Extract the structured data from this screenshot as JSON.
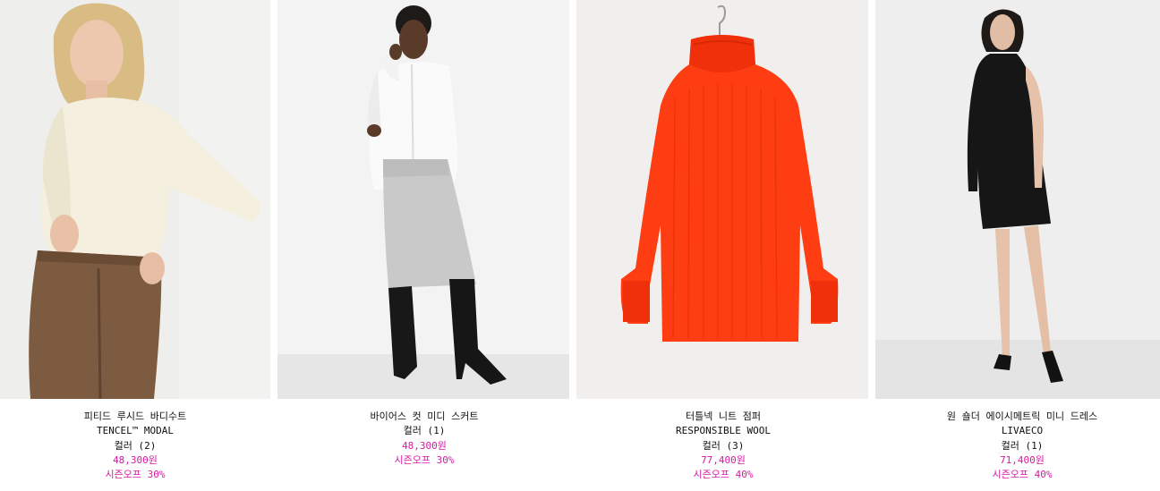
{
  "products": [
    {
      "name": "피티드 루시드 바디수트",
      "subtitle": "TENCEL™ MODAL",
      "colors": "컬러 (2)",
      "price": "48,300원",
      "sale": "시즌오프 30%",
      "image_alt": "ivory fitted bodysuit with brown tweed trousers"
    },
    {
      "name": "바이어스 컷 미디 스커트",
      "subtitle": "",
      "colors": "컬러 (1)",
      "price": "48,300원",
      "sale": "시즌오프 30%",
      "image_alt": "silver bias cut midi skirt with white shirt and black boots"
    },
    {
      "name": "터틀넥 니트 점퍼",
      "subtitle": "RESPONSIBLE WOOL",
      "colors": "컬러 (3)",
      "price": "77,400원",
      "sale": "시즌오프 40%",
      "image_alt": "red ribbed turtleneck knit jumper on hanger"
    },
    {
      "name": "원 숄더 에이시메트릭 미니 드레스",
      "subtitle": "LIVAECO",
      "colors": "컬러 (1)",
      "price": "71,400원",
      "sale": "시즌오프 40%",
      "image_alt": "black one shoulder asymmetric mini dress"
    }
  ],
  "colors": {
    "price_accent": "#d61aa0",
    "text": "#111111",
    "photo_bg": "#efefef",
    "jumper": "#ff3d12",
    "dress": "#161616",
    "bodysuit": "#f3eedc",
    "trousers": "#7a5a40"
  }
}
